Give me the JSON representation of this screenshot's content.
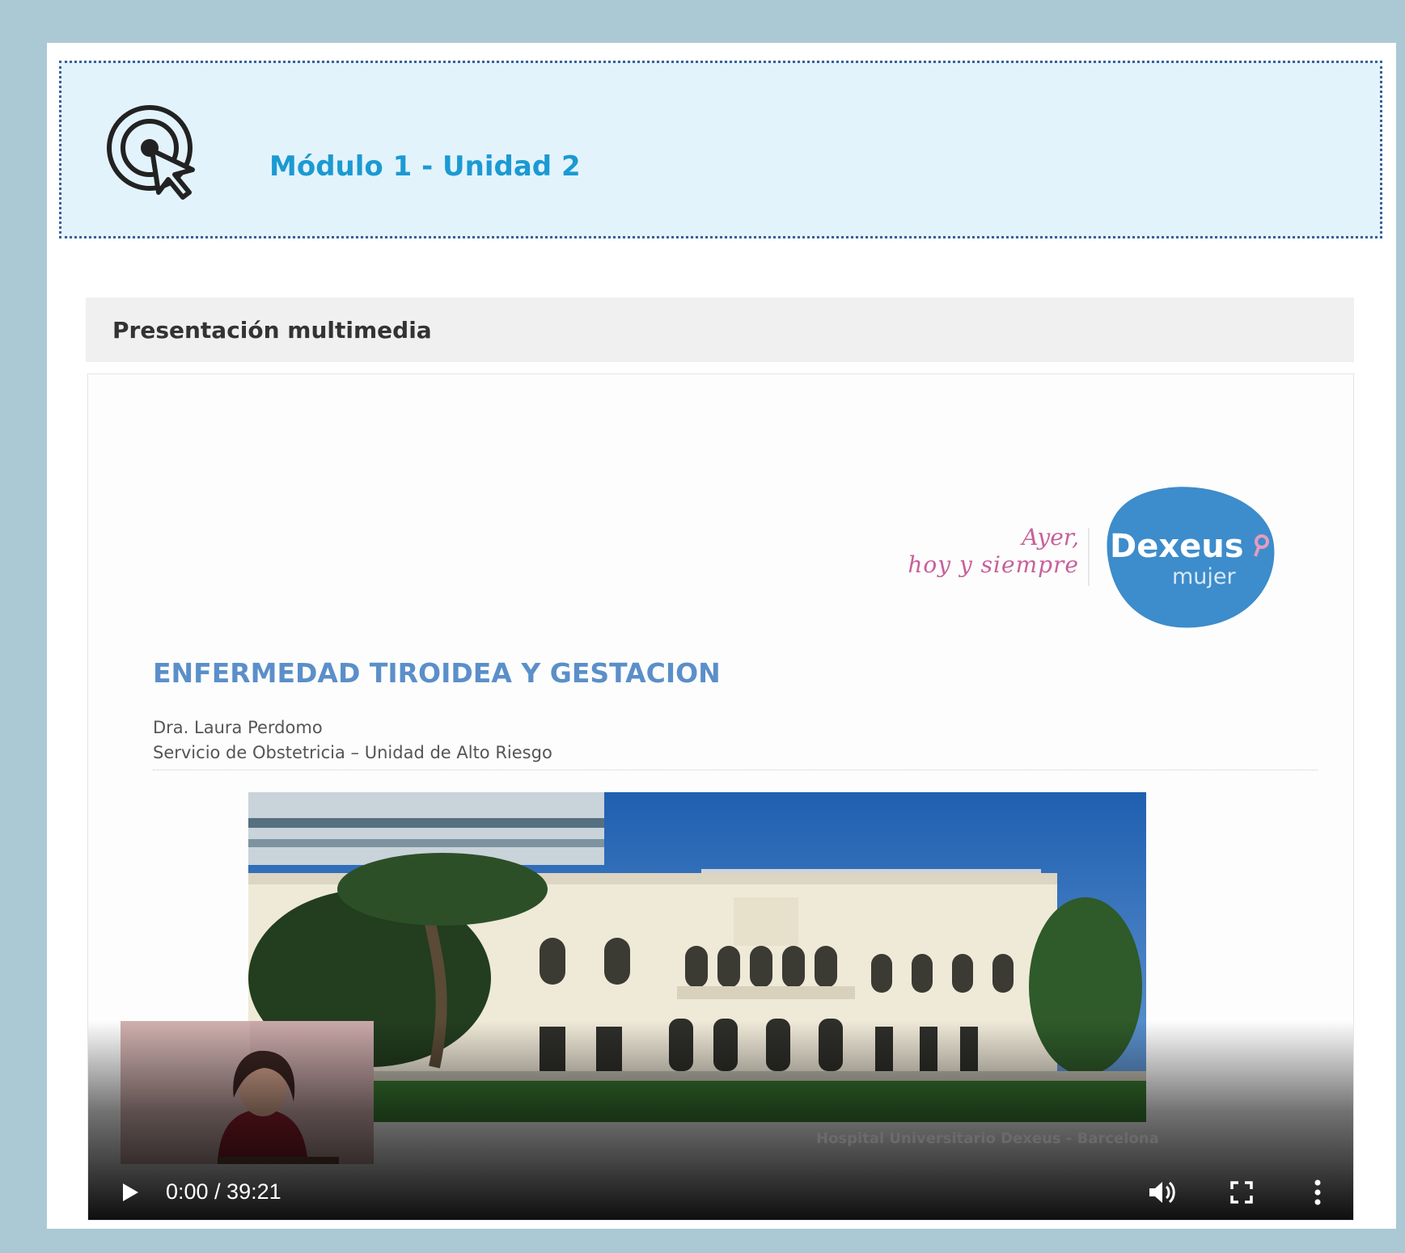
{
  "header": {
    "title": "Módulo 1 - Unidad 2",
    "icon": "target-cursor-icon"
  },
  "section": {
    "title": "Presentación multimedia"
  },
  "slide": {
    "slogan_line1": "Ayer,",
    "slogan_line2": "hoy y siempre",
    "logo_brand": "Dexeus",
    "logo_sub": "mujer",
    "title": "ENFERMEDAD TIROIDEA Y GESTACION",
    "author": "Dra. Laura Perdomo",
    "department": "Servicio de Obstetricia – Unidad de Alto Riesgo",
    "caption": "Hospital Universitario Dexeus - Barcelona"
  },
  "player": {
    "time": "0:00 / 39:21",
    "progress": 0.08,
    "icons": {
      "play": "play-icon",
      "volume": "volume-icon",
      "fullscreen": "fullscreen-icon",
      "more": "more-vertical-icon"
    }
  },
  "colors": {
    "page_background": "#abc9d4",
    "header_fill": "#e3f3fc",
    "header_border": "#3a5f99",
    "accent_title": "#1b9ad2",
    "slide_title": "#5b8fc9",
    "brand_blob": "#3d8ccb",
    "slogan": "#c8609a"
  }
}
